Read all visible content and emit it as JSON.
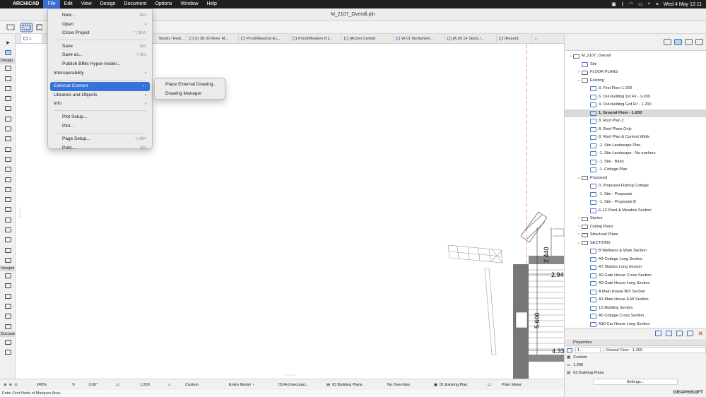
{
  "menubar": {
    "app": "ARCHICAD",
    "items": [
      "File",
      "Edit",
      "View",
      "Design",
      "Document",
      "Options",
      "Window",
      "Help"
    ],
    "clock": "Wed 4 May  12:11"
  },
  "window": {
    "title": "M_2107_Overall.pln"
  },
  "tabs": [
    "1.",
    "Studio / Herb...",
    "(I) 3D-10 River M...",
    "Pond/Meadow A [...",
    "Pond/Meadow B [...",
    "[Action Center]",
    "W-01 Worksheet...",
    "[A.09.14 Study /...",
    "[Report]"
  ],
  "toolbox": {
    "design_label": "Design",
    "viewpoint_label": "Viewpoi",
    "document_label": "Docume"
  },
  "file_menu": {
    "items": [
      {
        "label": "New...",
        "shortcut": "⌘N"
      },
      {
        "label": "Open",
        "shortcut": "›"
      },
      {
        "label": "Close Project",
        "shortcut": "⌥⌘W"
      },
      {
        "label": "Save",
        "shortcut": "⌘S"
      },
      {
        "label": "Save as...",
        "shortcut": "⇧⌘S"
      },
      {
        "label": "Publish BIMx Hyper-model...",
        "shortcut": ""
      },
      {
        "label": "Interoperability",
        "shortcut": "›"
      },
      {
        "label": "External Content",
        "shortcut": "›"
      },
      {
        "label": "Libraries and Objects",
        "shortcut": "›"
      },
      {
        "label": "Info",
        "shortcut": "›"
      },
      {
        "label": "Plot Setup...",
        "shortcut": ""
      },
      {
        "label": "Plot...",
        "shortcut": ""
      },
      {
        "label": "Page Setup...",
        "shortcut": "⌥⌘P"
      },
      {
        "label": "Print...",
        "shortcut": "⌘P"
      }
    ]
  },
  "submenu": {
    "items": [
      "Place External Drawing...",
      "Drawing Manager"
    ]
  },
  "canvas": {
    "dims": [
      "2.440",
      "2.94",
      "5.600",
      "4.33"
    ]
  },
  "statusbar": {
    "zoom": "245%",
    "angle": "0.00°",
    "scale": "1:200",
    "pen_set": "Custom",
    "model": "Entire Model",
    "view_set": "03 Architectural...",
    "layer": "03 Building Plans",
    "overrides": "No Overrides",
    "structure": "01 Existing Plan",
    "dim": "Plain Meter"
  },
  "hint": "Enter First Node of Marquee Area.",
  "navigator": {
    "rows": [
      {
        "label": "M_2107_Overall",
        "level": 0,
        "arrow": "v",
        "type": "f",
        "sel": false
      },
      {
        "label": "Site",
        "level": 1,
        "arrow": "",
        "type": "v",
        "sel": false
      },
      {
        "label": "FLOOR PLANS",
        "level": 1,
        "arrow": ">",
        "type": "f",
        "sel": false
      },
      {
        "label": "Existing",
        "level": 1,
        "arrow": "v",
        "type": "f",
        "sel": false
      },
      {
        "label": "3. First Floor 1-200",
        "level": 2,
        "arrow": "",
        "type": "v",
        "sel": false
      },
      {
        "label": "6. Out-building 1st Flr - 1-200",
        "level": 2,
        "arrow": "",
        "type": "v",
        "sel": false
      },
      {
        "label": "4. Out-building Grd Flr - 1-200",
        "level": 2,
        "arrow": "",
        "type": "v",
        "sel": false
      },
      {
        "label": "1. Ground Floor - 1-200",
        "level": 2,
        "arrow": "",
        "type": "v",
        "sel": true
      },
      {
        "label": "8. Roof Plan 2",
        "level": 2,
        "arrow": "",
        "type": "v",
        "sel": false
      },
      {
        "label": "8. Roof Plans Only",
        "level": 2,
        "arrow": "",
        "type": "v",
        "sel": false
      },
      {
        "label": "8. Roof Plan & Context Walls",
        "level": 2,
        "arrow": "",
        "type": "v",
        "sel": false
      },
      {
        "label": "-1. Site Landscape Plan",
        "level": 2,
        "arrow": "",
        "type": "v",
        "sel": false
      },
      {
        "label": "-1. Site Landscape - No markers",
        "level": 2,
        "arrow": "",
        "type": "v",
        "sel": false
      },
      {
        "label": "-1. Site - Basic",
        "level": 2,
        "arrow": "",
        "type": "v",
        "sel": false
      },
      {
        "label": "-1. Cottage Plan",
        "level": 2,
        "arrow": "",
        "type": "v",
        "sel": false
      },
      {
        "label": "Proposed",
        "level": 1,
        "arrow": "v",
        "type": "f",
        "sel": false
      },
      {
        "label": "0. Proposed Fishing Cottage",
        "level": 2,
        "arrow": "",
        "type": "v",
        "sel": false
      },
      {
        "label": "-1. Site - Proposals",
        "level": 2,
        "arrow": "",
        "type": "v",
        "sel": false
      },
      {
        "label": "-1. Site - Proposals B",
        "level": 2,
        "arrow": "",
        "type": "v",
        "sel": false
      },
      {
        "label": "E-12 Pond & Meadow Section",
        "level": 2,
        "arrow": "",
        "type": "v",
        "sel": false
      },
      {
        "label": "Stories",
        "level": 1,
        "arrow": ">",
        "type": "f",
        "sel": false
      },
      {
        "label": "Ceiling Plans",
        "level": 1,
        "arrow": ">",
        "type": "f",
        "sel": false
      },
      {
        "label": "Structural Plans",
        "level": 1,
        "arrow": ">",
        "type": "f",
        "sel": false
      },
      {
        "label": "SECTIONS",
        "level": 1,
        "arrow": "v",
        "type": "f",
        "sel": false
      },
      {
        "label": "B Wellness & Work Section",
        "level": 2,
        "arrow": "",
        "type": "v",
        "sel": false
      },
      {
        "label": "A4 Cottage Long Section",
        "level": 2,
        "arrow": "",
        "type": "v",
        "sel": false
      },
      {
        "label": "A7 Stables Long Section",
        "level": 2,
        "arrow": "",
        "type": "v",
        "sel": false
      },
      {
        "label": "A2 Gate House Cross Section",
        "level": 2,
        "arrow": "",
        "type": "v",
        "sel": false
      },
      {
        "label": "A3 Gate House Long Section",
        "level": 2,
        "arrow": "",
        "type": "v",
        "sel": false
      },
      {
        "label": "A Main House N/S Section",
        "level": 2,
        "arrow": "",
        "type": "v",
        "sel": false
      },
      {
        "label": "A1 Main House E/W Section",
        "level": 2,
        "arrow": "",
        "type": "v",
        "sel": false
      },
      {
        "label": "1S Building Section",
        "level": 2,
        "arrow": "",
        "type": "v",
        "sel": false
      },
      {
        "label": "A5 Cottage Cross Section",
        "level": 2,
        "arrow": "",
        "type": "v",
        "sel": false
      },
      {
        "label": "A10 Car House Long Section",
        "level": 2,
        "arrow": "",
        "type": "v",
        "sel": false
      }
    ]
  },
  "properties": {
    "title": "Properties",
    "id": "1.",
    "name": "Ground Floor - 1-200",
    "pen": "Custom",
    "scale": "1:200",
    "layer": "03 Building Plans",
    "settings": "Settings...",
    "brand": "GRAPHISOFT"
  }
}
